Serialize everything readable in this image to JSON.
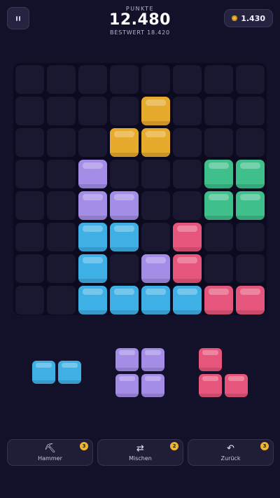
{
  "header": {
    "score_label": "PUNKTE",
    "score_value": "12.480",
    "best_label": "BESTWERT",
    "best_value": "18.420",
    "coins_value": "1.430",
    "pause_icon": "pause-icon",
    "coin_icon": "coin-icon"
  },
  "colors": {
    "yellow": "#e6aa2c",
    "purple": "#a48de6",
    "green": "#3fbf8c",
    "blue": "#3fb0e6",
    "pink": "#e6557c",
    "empty": "#1a1731",
    "background": "#13102a"
  },
  "board": {
    "rows": 8,
    "cols": 8,
    "filled": [
      {
        "r": 1,
        "c": 4,
        "color": "yellow"
      },
      {
        "r": 2,
        "c": 3,
        "color": "yellow"
      },
      {
        "r": 2,
        "c": 4,
        "color": "yellow"
      },
      {
        "r": 3,
        "c": 2,
        "color": "purple"
      },
      {
        "r": 3,
        "c": 6,
        "color": "green"
      },
      {
        "r": 3,
        "c": 7,
        "color": "green"
      },
      {
        "r": 4,
        "c": 2,
        "color": "purple"
      },
      {
        "r": 4,
        "c": 3,
        "color": "purple"
      },
      {
        "r": 4,
        "c": 6,
        "color": "green"
      },
      {
        "r": 4,
        "c": 7,
        "color": "green"
      },
      {
        "r": 5,
        "c": 2,
        "color": "blue"
      },
      {
        "r": 5,
        "c": 3,
        "color": "blue"
      },
      {
        "r": 5,
        "c": 5,
        "color": "pink"
      },
      {
        "r": 6,
        "c": 2,
        "color": "blue"
      },
      {
        "r": 6,
        "c": 4,
        "color": "purple"
      },
      {
        "r": 6,
        "c": 5,
        "color": "pink"
      },
      {
        "r": 7,
        "c": 2,
        "color": "blue"
      },
      {
        "r": 7,
        "c": 3,
        "color": "blue"
      },
      {
        "r": 7,
        "c": 4,
        "color": "blue"
      },
      {
        "r": 7,
        "c": 5,
        "color": "blue"
      },
      {
        "r": 7,
        "c": 6,
        "color": "pink"
      },
      {
        "r": 7,
        "c": 7,
        "color": "pink"
      }
    ]
  },
  "tray": [
    {
      "name": "tray-piece-blue-bar",
      "color": "blue",
      "cells": [
        [
          0,
          0
        ],
        [
          0,
          1
        ]
      ]
    },
    {
      "name": "tray-piece-purple-square",
      "color": "purple",
      "cells": [
        [
          0,
          0
        ],
        [
          0,
          1
        ],
        [
          1,
          0
        ],
        [
          1,
          1
        ]
      ]
    },
    {
      "name": "tray-piece-pink-l",
      "color": "pink",
      "cells": [
        [
          0,
          0
        ],
        [
          1,
          0
        ],
        [
          1,
          1
        ]
      ]
    }
  ],
  "powerups": [
    {
      "name": "hammer-button",
      "icon_name": "hammer-icon",
      "icon": "⛏",
      "label": "Hammer",
      "count": "3"
    },
    {
      "name": "shuffle-button",
      "icon_name": "shuffle-icon",
      "icon": "⇄",
      "label": "Mischen",
      "count": "2"
    },
    {
      "name": "undo-button",
      "icon_name": "undo-icon",
      "icon": "↶",
      "label": "Zurück",
      "count": "3"
    }
  ]
}
